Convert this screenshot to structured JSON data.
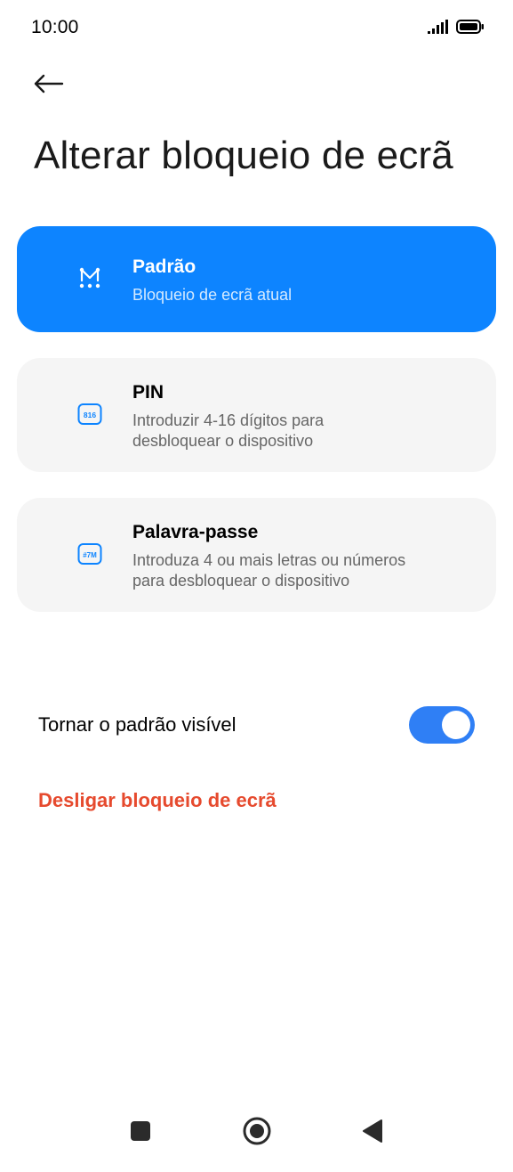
{
  "status_bar": {
    "time": "10:00",
    "icons": [
      "signal-icon",
      "battery-icon"
    ]
  },
  "header": {
    "back_icon": "back-arrow-icon",
    "title": "Alterar bloqueio de ecrã"
  },
  "options": [
    {
      "id": "pattern",
      "icon": "pattern-icon",
      "title": "Padrão",
      "description": "Bloqueio de ecrã atual",
      "selected": true
    },
    {
      "id": "pin",
      "icon": "pin-icon",
      "icon_text": "816",
      "title": "PIN",
      "description_line1": "Introduzir 4-16 dígitos para",
      "description_line2": "desbloquear o dispositivo",
      "selected": false
    },
    {
      "id": "password",
      "icon": "password-icon",
      "icon_text": "#7M",
      "title": "Palavra-passe",
      "description_line1": "Introduza 4 ou mais letras ou números",
      "description_line2": "para desbloquear o dispositivo",
      "selected": false
    }
  ],
  "visible_pattern": {
    "label": "Tornar o padrão visível",
    "enabled": true
  },
  "disable_lock": {
    "label": "Desligar bloqueio de ecrã"
  },
  "nav_bar": {
    "icons": [
      "recent-apps-icon",
      "home-icon",
      "back-icon"
    ]
  },
  "colors": {
    "accent": "#0d84ff",
    "toggle": "#2f7ff5",
    "danger": "#e64a2e",
    "card_bg": "#f5f5f5"
  }
}
